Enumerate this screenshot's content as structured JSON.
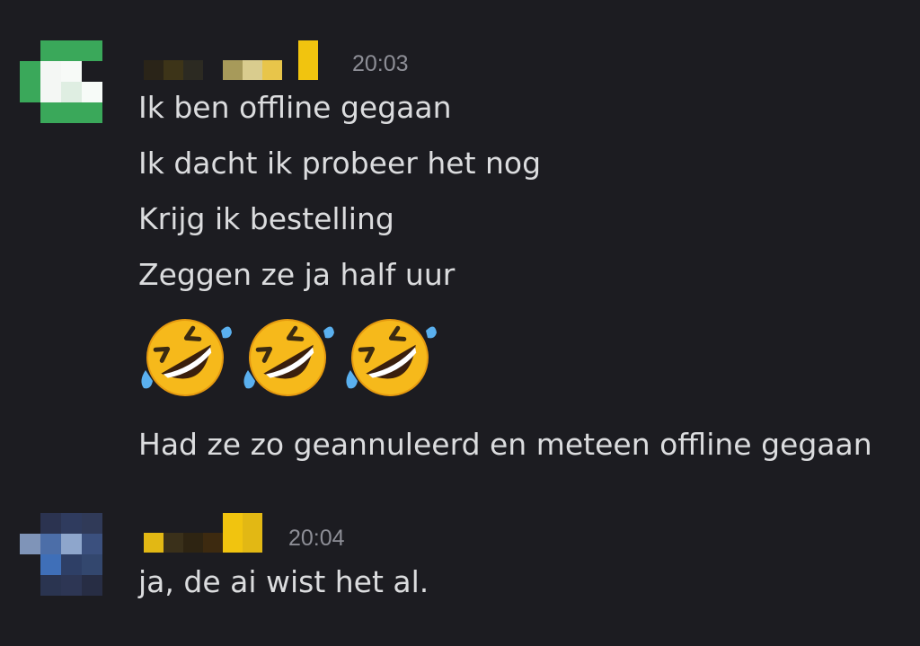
{
  "messages": [
    {
      "timestamp": "20:03",
      "lines": [
        "Ik ben offline gegaan",
        "Ik dacht ik probeer het nog",
        "Krijg ik bestelling",
        "Zeggen ze ja half uur"
      ],
      "emoji": [
        "rolling-on-floor-laughing",
        "rolling-on-floor-laughing",
        "rolling-on-floor-laughing"
      ],
      "after_emoji": "Had ze zo geannuleerd en meteen offline gegaan"
    },
    {
      "timestamp": "20:04",
      "lines": [
        "ja, de ai wist het al."
      ]
    }
  ],
  "colors": {
    "background": "#1c1c21",
    "message_text": "#dbdcde",
    "timestamp": "#8d8e96",
    "avatar1_accent": "#3aa85a",
    "avatar2_accent": "#3f6fb8",
    "name_accent": "#f1c40f"
  }
}
